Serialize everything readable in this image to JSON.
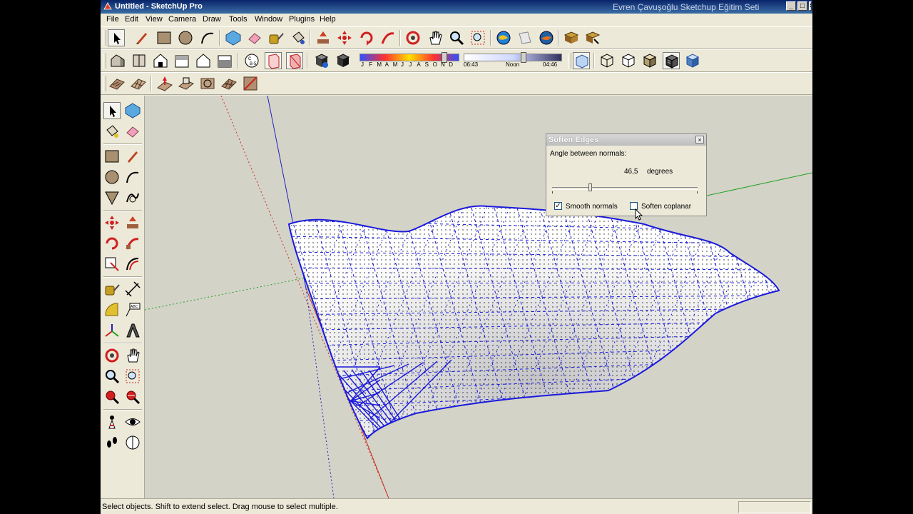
{
  "window": {
    "title": "Untitled - SketchUp Pro",
    "watermark": "Evren Çavuşoğlu Sketchup Eğitim Seti",
    "controls": {
      "minimize": "_",
      "maximize": "□",
      "close": "×"
    }
  },
  "menu": [
    "File",
    "Edit",
    "View",
    "Camera",
    "Draw",
    "Tools",
    "Window",
    "Plugins",
    "Help"
  ],
  "shadow_settings": {
    "months": [
      "J",
      "F",
      "M",
      "A",
      "M",
      "J",
      "J",
      "A",
      "S",
      "O",
      "N",
      "D"
    ],
    "time_start": "06:43",
    "time_mid": "Noon",
    "time_end": "04:46"
  },
  "soften_edges": {
    "title": "Soften Edges",
    "close": "×",
    "angle_label": "Angle between normals:",
    "angle_value": "46,5",
    "angle_unit": "degrees",
    "slider_fraction": 0.26,
    "smooth_normals_label": "Smooth normals",
    "smooth_normals_checked": "✓",
    "soften_coplanar_label": "Soften coplanar",
    "soften_coplanar_checked": ""
  },
  "status": {
    "text": "Select objects. Shift to extend select. Drag mouse to select multiple."
  },
  "colors": {
    "titlebar": "#0a246a",
    "viewport_bg": "#d4d3c8",
    "mesh_edge": "#1a1adc",
    "axis_red": "#c83020",
    "axis_green": "#20a020",
    "axis_blue": "#2020c0"
  }
}
